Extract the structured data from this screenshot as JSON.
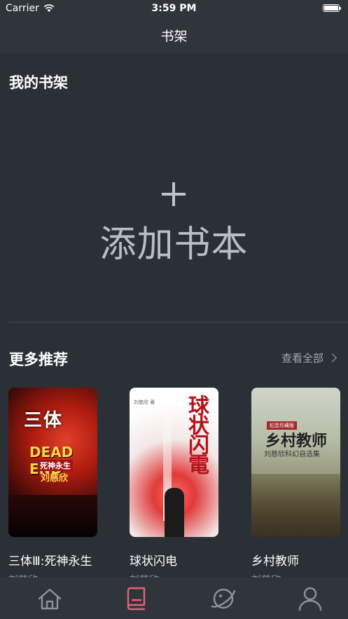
{
  "status_bar": {
    "carrier": "Carrier",
    "time": "3:59 PM"
  },
  "nav": {
    "title": "书架"
  },
  "my_shelf": {
    "title": "我的书架",
    "add_label": "添加书本"
  },
  "recommend": {
    "title": "更多推荐",
    "see_all": "查看全部",
    "books": [
      {
        "title": "三体Ⅲ:死神永生",
        "author": "刘慈欣",
        "cover_text": "三体",
        "cover_big": "DEAD END",
        "cover_sub": "死神永生",
        "cover_author": "刘慈欣"
      },
      {
        "title": "球状闪电",
        "author": "刘慈欣",
        "cover_text": "球状闪電",
        "cover_small": "刘慈欣 著"
      },
      {
        "title": "乡村教师",
        "author": "刘慈欣",
        "cover_text": "乡村教师",
        "cover_sub": "刘慈欣科幻自选集",
        "cover_ribbon": "纪念珍藏版"
      }
    ]
  },
  "tabs": [
    {
      "name": "home",
      "icon": "home-icon",
      "active": false
    },
    {
      "name": "bookshelf",
      "icon": "book-icon",
      "active": true
    },
    {
      "name": "discover",
      "icon": "planet-icon",
      "active": false
    },
    {
      "name": "profile",
      "icon": "user-icon",
      "active": false
    }
  ],
  "colors": {
    "accent": "#e8607a",
    "tab_inactive": "#8d939b",
    "background": "#2b3036"
  }
}
